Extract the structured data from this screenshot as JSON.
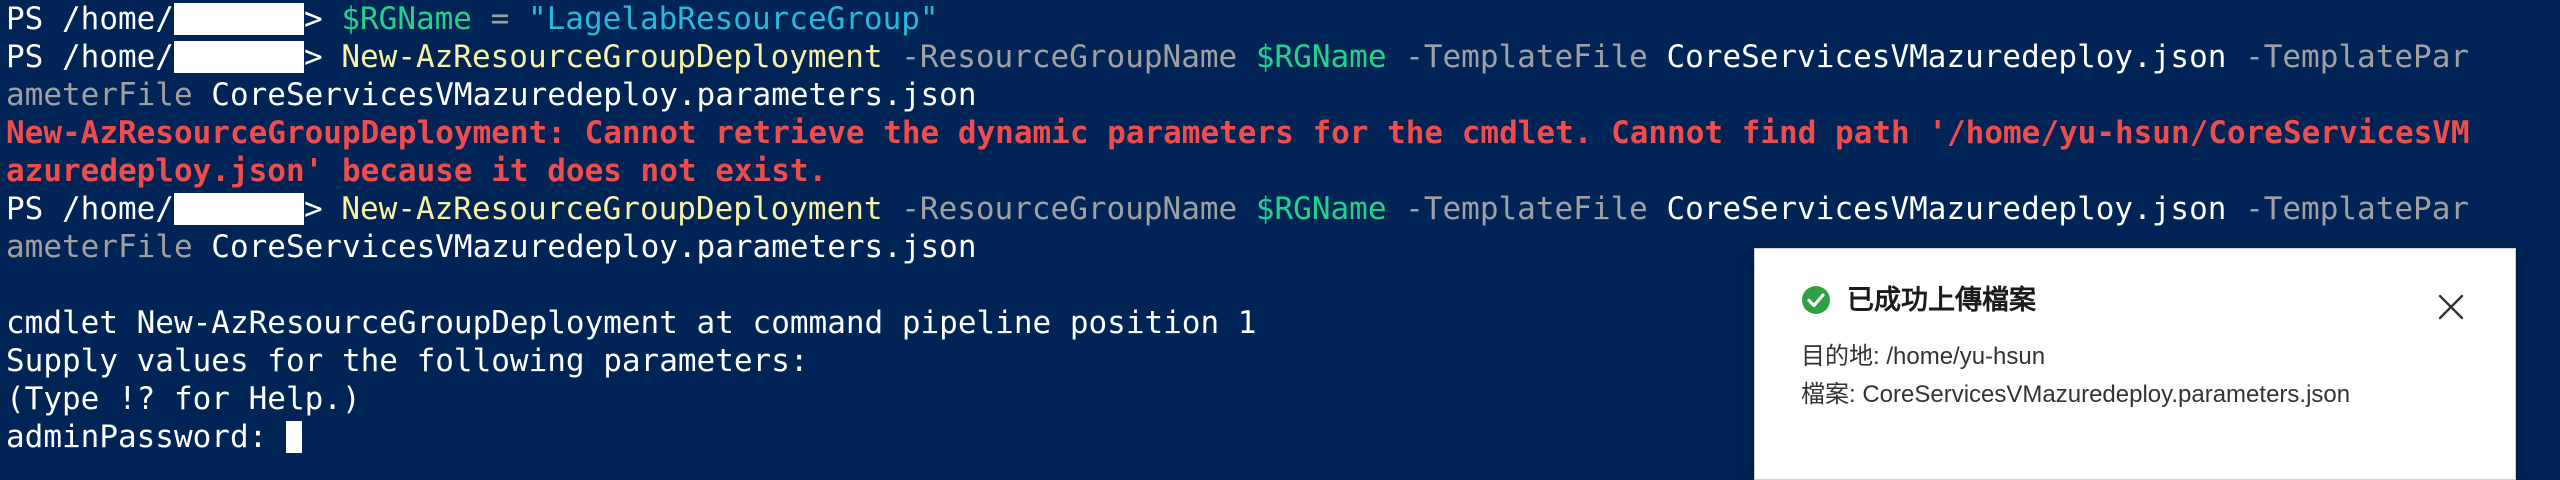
{
  "terminal": {
    "prompt_prefix": "PS /home/",
    "prompt_suffix": ">",
    "line1": {
      "var": "$RGName",
      "op": " = ",
      "str": "\"LagelabResourceGroup\""
    },
    "cmd_line": {
      "cmd": "New-AzResourceGroupDeployment",
      "p1": " -ResourceGroupName ",
      "v1": "$RGName",
      "p2": " -TemplateFile ",
      "a2": "CoreServicesVMazuredeploy.json",
      "p3": " -TemplatePar",
      "p3_cont": "ameterFile",
      "a3": " CoreServicesVMazuredeploy.parameters.json"
    },
    "error_line1": "New-AzResourceGroupDeployment: Cannot retrieve the dynamic parameters for the cmdlet. Cannot find path '/home/yu-hsun/CoreServicesVM",
    "error_line2": "azuredeploy.json' because it does not exist.",
    "output": [
      "cmdlet New-AzResourceGroupDeployment at command pipeline position 1",
      "Supply values for the following parameters:",
      "(Type !? for Help.)"
    ],
    "input_label": "adminPassword: "
  },
  "toast": {
    "title": "已成功上傳檔案",
    "destination": "目的地: /home/yu-hsun",
    "file": "檔案: CoreServicesVMazuredeploy.parameters.json",
    "success_color": "#2ea043"
  }
}
